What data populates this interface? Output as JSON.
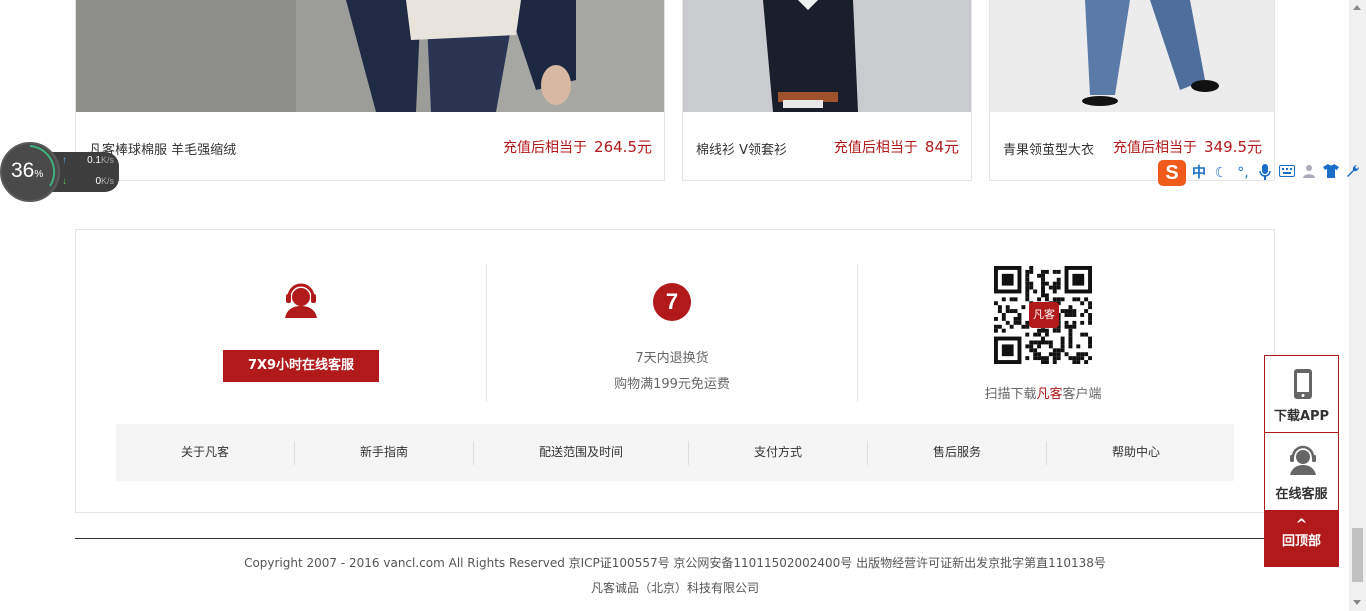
{
  "products": [
    {
      "name": "凡客棒球棉服 羊毛强缩绒",
      "price_label": "充值后相当于",
      "price": "264.5元"
    },
    {
      "name": "棉线衫 V领套衫",
      "price_label": "充值后相当于",
      "price": "84元"
    },
    {
      "name": "青果领茧型大衣",
      "price_label": "充值后相当于",
      "price": "349.5元"
    }
  ],
  "service": {
    "kefu_button": "7X9小时在线客服",
    "icon_7_text": "7",
    "return_text": "7天内退换货",
    "shipping_text": "购物满199元免运费",
    "qr_badge": "凡客",
    "qr_caption_pre": "扫描下载",
    "qr_caption_brand": "凡客",
    "qr_caption_post": "客户端"
  },
  "footer_links": [
    "关于凡客",
    "新手指南",
    "配送范围及时间",
    "支付方式",
    "售后服务",
    "帮助中心"
  ],
  "copyright": {
    "line1": "Copyright 2007 - 2016 vancl.com All Rights Reserved 京ICP证100557号 京公网安备11011502002400号 出版物经营许可证新出发京批字第直110138号",
    "line2": "凡客诚品（北京）科技有限公司"
  },
  "float_bar": {
    "download_app": "下载APP",
    "online_service": "在线客服",
    "back_top_caret": "^",
    "back_top": "回顶部"
  },
  "speed_widget": {
    "percent": "36",
    "percent_unit": "%",
    "up_value": "0.1",
    "up_unit": "K/s",
    "down_value": "0",
    "down_unit": "K/s"
  },
  "ime": {
    "logo": "S",
    "mode": "中"
  },
  "colors": {
    "brand_red": "#b1191a",
    "border": "#e5e5e5",
    "links_bg": "#f5f5f5"
  }
}
